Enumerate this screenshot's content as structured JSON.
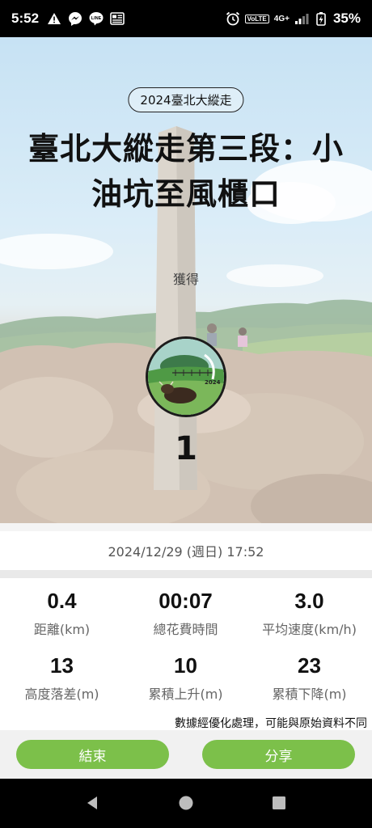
{
  "status_bar": {
    "time": "5:52",
    "left_icons": [
      "warning-icon",
      "messenger-icon",
      "line-icon",
      "news-icon"
    ],
    "network": "4G+",
    "volte": "VoLTE",
    "battery": "35%"
  },
  "hero": {
    "event_tag": "2024臺北大縱走",
    "title_line1": "臺北大縱走第三段：小",
    "title_line2": "油坑至風櫃口",
    "earned_label": "獲得",
    "badge_text": "2024",
    "count": "1"
  },
  "date": "2024/12/29 (週日) 17:52",
  "stats": [
    {
      "value": "0.4",
      "label": "距離(km)"
    },
    {
      "value": "00:07",
      "label": "總花費時間"
    },
    {
      "value": "3.0",
      "label": "平均速度(km/h)"
    },
    {
      "value": "13",
      "label": "高度落差(m)"
    },
    {
      "value": "10",
      "label": "累積上升(m)"
    },
    {
      "value": "23",
      "label": "累積下降(m)"
    }
  ],
  "note": "數據經優化處理，可能與原始資料不同",
  "buttons": {
    "end": "結束",
    "share": "分享"
  },
  "colors": {
    "accent": "#7cc04a",
    "status_bar": "#000000"
  }
}
